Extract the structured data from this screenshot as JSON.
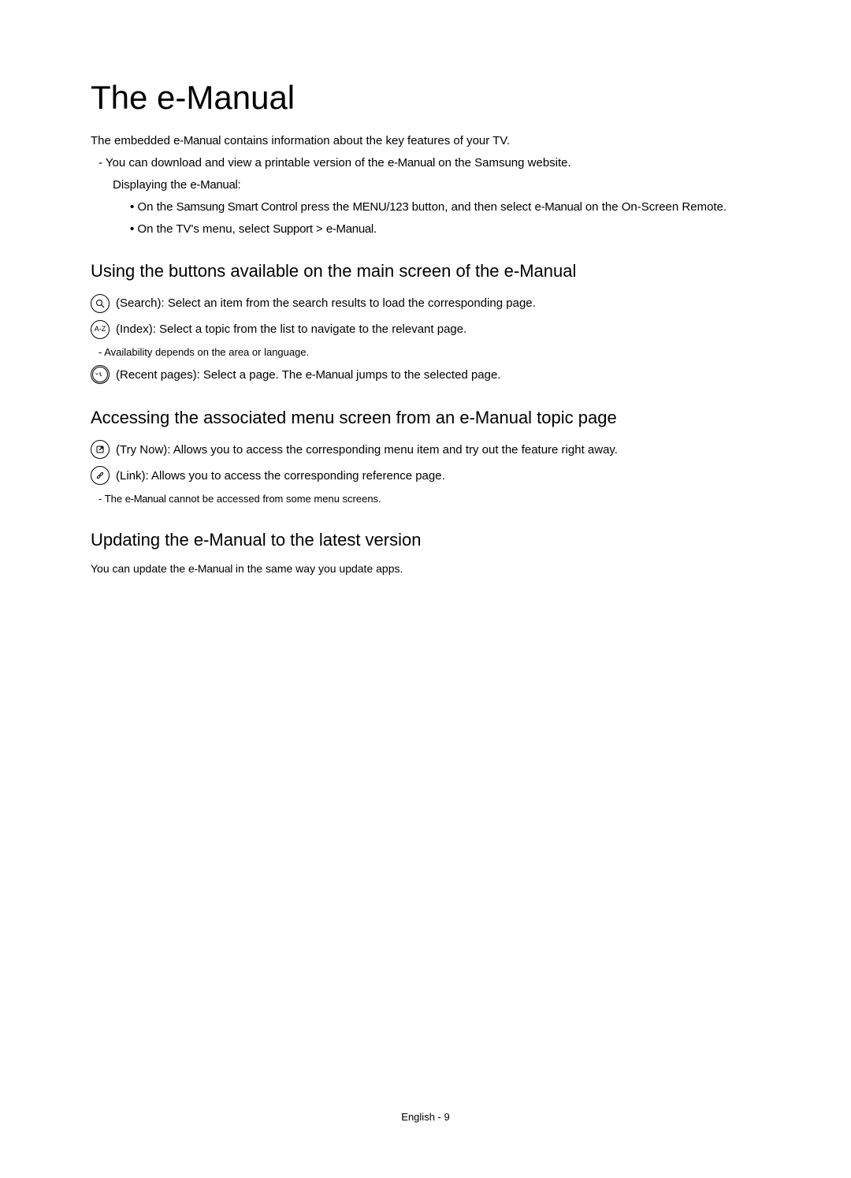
{
  "title": "The e-Manual",
  "intro": {
    "line1_a": "The embedded ",
    "line1_b": "e-Manual",
    "line1_c": " contains information about the key features of your TV.",
    "dash1_a": "You can download and view a printable version of the ",
    "dash1_b": "e-Manual",
    "dash1_c": " on the Samsung website.",
    "indent1_a": "Displaying the ",
    "indent1_b": "e-Manual",
    "indent1_c": ":",
    "bullet1_a": "On the ",
    "bullet1_b": "Samsung Smart Control",
    "bullet1_c": " press the ",
    "bullet1_d": "MENU/123",
    "bullet1_e": " button, and then select ",
    "bullet1_f": "e-Manual",
    "bullet1_g": " on the On-Screen Remote.",
    "bullet2_a": "On the TV's menu, select ",
    "bullet2_b": "Support",
    "bullet2_c": " > ",
    "bullet2_d": "e-Manual",
    "bullet2_e": "."
  },
  "section1": {
    "heading": "Using the buttons available on the main screen of the e-Manual",
    "search_label": "Search",
    "search_text": ": Select an item from the search results to load the corresponding page.",
    "index_label": "Index",
    "index_text": ": Select a topic from the list to navigate to the relevant page.",
    "note": "Availability depends on the area or language.",
    "recent_label": "Recent pages",
    "recent_text_a": ": Select a page. The ",
    "recent_text_b": "e-Manual",
    "recent_text_c": " jumps to the selected page."
  },
  "section2": {
    "heading": "Accessing the associated menu screen from an e-Manual topic page",
    "trynow_label": "Try Now",
    "trynow_text": ": Allows you to access the corresponding menu item and try out the feature right away.",
    "link_label": "Link",
    "link_text": ": Allows you to access the corresponding reference page.",
    "note_a": "The ",
    "note_b": "e-Manual",
    "note_c": " cannot be accessed from some menu screens."
  },
  "section3": {
    "heading": "Updating the e-Manual to the latest version",
    "text_a": "You can update the ",
    "text_b": "e-Manual",
    "text_c": " in the same way you update apps."
  },
  "footer": "English - 9",
  "icons": {
    "index_text": "A-Z"
  }
}
